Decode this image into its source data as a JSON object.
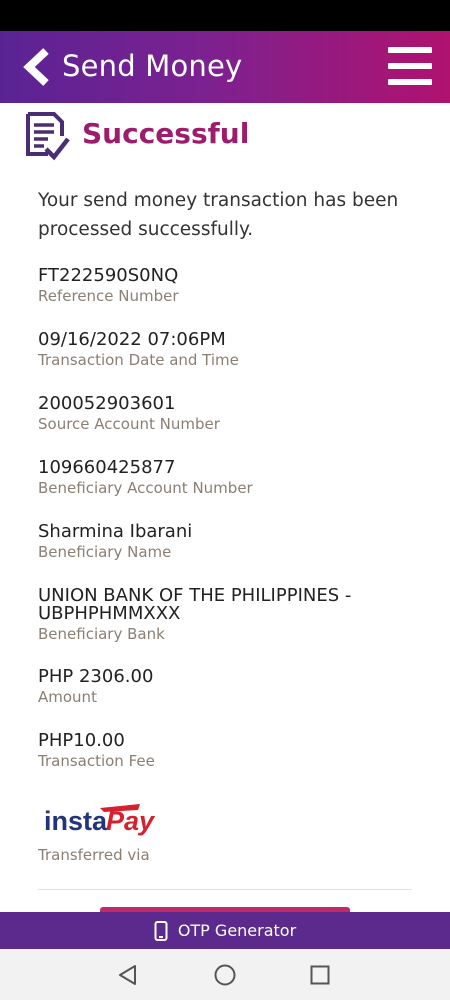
{
  "header": {
    "title": "Send Money",
    "back_icon": "chevron-left-icon",
    "menu_icon": "hamburger-menu-icon"
  },
  "status": {
    "icon": "document-check-icon",
    "title": "Successful",
    "color": "#9b1d6b"
  },
  "message": "Your send money transaction has been processed successfully.",
  "details": [
    {
      "value": "FT222590S0NQ",
      "label": "Reference Number"
    },
    {
      "value": "09/16/2022 07:06PM",
      "label": "Transaction Date and Time"
    },
    {
      "value": "200052903601",
      "label": "Source Account Number"
    },
    {
      "value": "109660425877",
      "label": "Beneficiary Account Number"
    },
    {
      "value": "Sharmina Ibarani",
      "label": "Beneficiary Name"
    },
    {
      "value": "UNION BANK OF THE PHILIPPINES - UBPHPHMMXXX",
      "label": "Beneficiary Bank"
    },
    {
      "value": "PHP 2306.00",
      "label": "Amount"
    },
    {
      "value": "PHP10.00",
      "label": "Transaction Fee"
    }
  ],
  "transfer": {
    "logo_text_1": "insta",
    "logo_text_2": "Pay",
    "label": "Transferred via"
  },
  "otp": {
    "icon": "phone-icon",
    "label": "OTP Generator"
  },
  "colors": {
    "header_start": "#5a2394",
    "header_end": "#b0126f",
    "otp_bar": "#5b2a8c",
    "label_text": "#8a7f73"
  }
}
